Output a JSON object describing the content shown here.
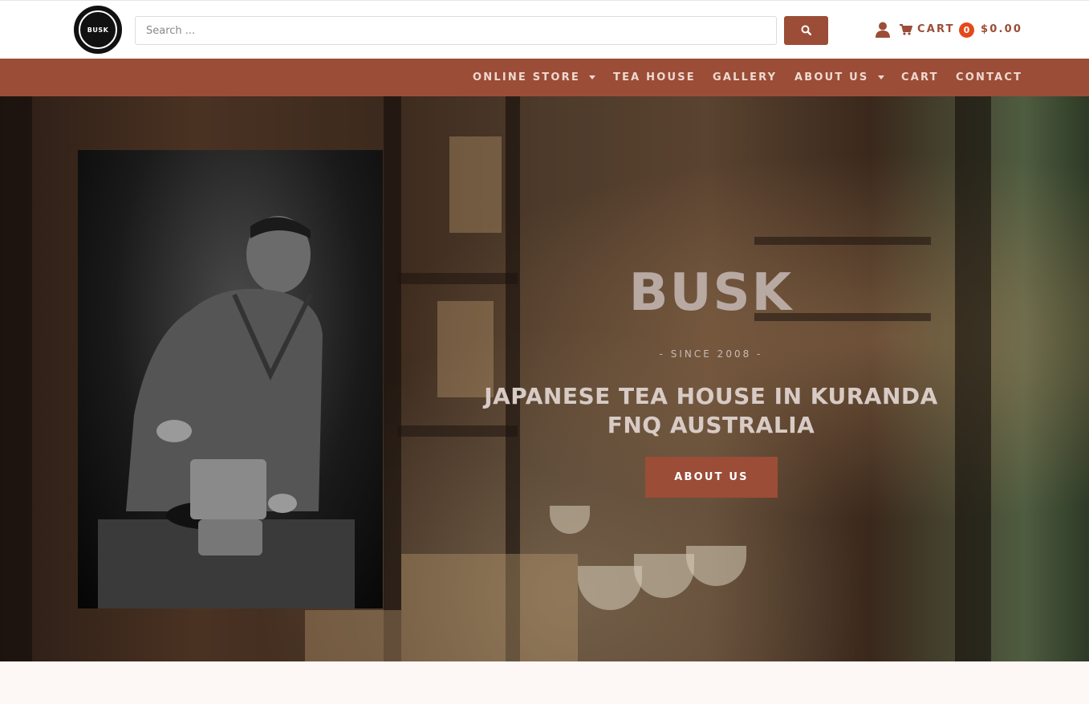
{
  "header": {
    "logo_text": "BUSK",
    "search": {
      "placeholder": "Search ...",
      "value": ""
    },
    "search_icon": "search-icon",
    "account_icon": "user-icon",
    "cart": {
      "icon": "cart-icon",
      "label": "CART",
      "count": "0",
      "total": "$0.00"
    }
  },
  "nav": {
    "items": [
      {
        "label": "ONLINE STORE",
        "has_dropdown": true
      },
      {
        "label": "TEA HOUSE",
        "has_dropdown": false
      },
      {
        "label": "GALLERY",
        "has_dropdown": false
      },
      {
        "label": "ABOUT US",
        "has_dropdown": true
      },
      {
        "label": "CART",
        "has_dropdown": false
      },
      {
        "label": "CONTACT",
        "has_dropdown": false
      }
    ]
  },
  "hero": {
    "title": "BUSK",
    "since": "- SINCE 2008 -",
    "subtitle_line1": "JAPANESE TEA HOUSE IN KURANDA",
    "subtitle_line2": "FNQ AUSTRALIA",
    "button_label": "ABOUT US"
  },
  "colors": {
    "accent": "#9b4d37",
    "cart_badge": "#e3491a",
    "nav_text": "#f0d9d0",
    "page_background": "#fdf8f6"
  }
}
